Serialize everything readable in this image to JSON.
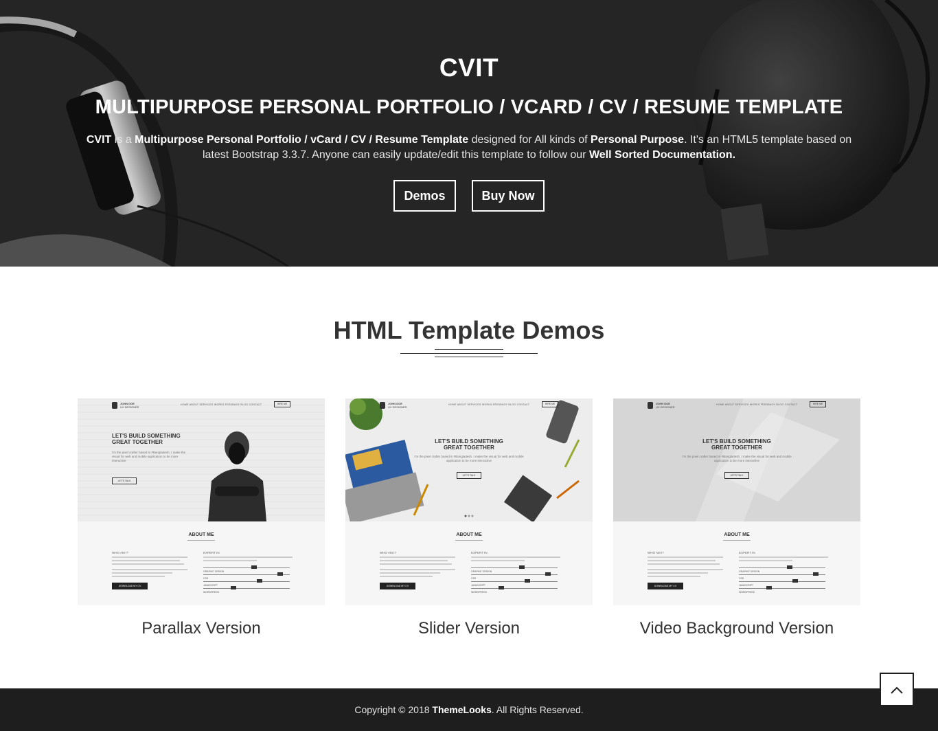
{
  "hero": {
    "title": "CVIT",
    "subtitle": "MULTIPURPOSE PERSONAL PORTFOLIO / VCARD / CV / RESUME TEMPLATE",
    "desc_parts": {
      "p1": "CVIT",
      "p2": " is a ",
      "p3": "Multipurpose Personal Portfolio / vCard / CV / Resume Template",
      "p4": " designed for All kinds of ",
      "p5": "Personal Purpose",
      "p6": ". It's an HTML5 template based on latest Bootstrap 3.3.7. Anyone can easily update/edit this template to follow our ",
      "p7": "Well Sorted Documentation."
    },
    "btn_demos": "Demos",
    "btn_buy": "Buy Now"
  },
  "demos": {
    "heading": "HTML Template Demos",
    "cards": [
      {
        "label": "Parallax Version"
      },
      {
        "label": "Slider Version"
      },
      {
        "label": "Video Background Version"
      }
    ],
    "thumb": {
      "brand": "JOHN DOE",
      "brand_sub": "UX DESIGNER",
      "menu": "HOME   ABOUT   SERVICES   WORKS   FEEDBACK   BLOG   CONTACT",
      "hire": "HIRE ME",
      "headline_1": "LET'S BUILD SOMETHING",
      "headline_2": "GREAT TOGETHER",
      "intro": "I'm the pixel crafter based in #Bangladesh. I make the visual for web and mobile application to be more interactive",
      "cta": "LET'S TALK",
      "about": "ABOUT ME",
      "who": "WHO AM I?",
      "expert": "EXPERT IN",
      "skills": [
        "GRAPHIC DESIGN",
        "CSS",
        "JAVASCRIPT",
        "WORDPRESS"
      ],
      "download": "DOWNLOAD MY CV"
    }
  },
  "footer": {
    "pre": "Copyright © 2018 ",
    "brand": "ThemeLooks",
    "post": ". All Rights Reserved."
  },
  "colors": {
    "hero_bg": "#2a2a2a",
    "footer_bg": "#1e1e1e",
    "text_dark": "#333333"
  },
  "icons": {
    "back_to_top": "chevron-up-icon"
  }
}
